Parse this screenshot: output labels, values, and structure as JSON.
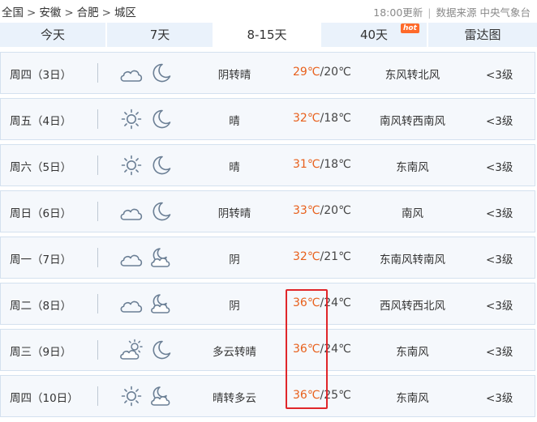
{
  "breadcrumb": [
    "全国",
    "安徽",
    "合肥",
    "城区"
  ],
  "breadcrumb_separator": ">",
  "update_time": "18:00更新",
  "data_source": "数据来源 中央气象台",
  "tabs": [
    {
      "label": "今天"
    },
    {
      "label": "7天"
    },
    {
      "label": "8-15天",
      "active": true
    },
    {
      "label": "40天",
      "badge": "hot"
    },
    {
      "label": "雷达图"
    }
  ],
  "forecast": [
    {
      "day": "周四（3日）",
      "icon_day": "cloud-icon",
      "icon_night": "moon-icon",
      "condition": "阴转晴",
      "high": "29℃",
      "low": "/20℃",
      "wind": "东风转北风",
      "level": "<3级"
    },
    {
      "day": "周五（4日）",
      "icon_day": "sun-icon",
      "icon_night": "moon-icon",
      "condition": "晴",
      "high": "32℃",
      "low": "/18℃",
      "wind": "南风转西南风",
      "level": "<3级"
    },
    {
      "day": "周六（5日）",
      "icon_day": "sun-icon",
      "icon_night": "moon-icon",
      "condition": "晴",
      "high": "31℃",
      "low": "/18℃",
      "wind": "东南风",
      "level": "<3级"
    },
    {
      "day": "周日（6日）",
      "icon_day": "cloud-icon",
      "icon_night": "moon-icon",
      "condition": "阴转晴",
      "high": "33℃",
      "low": "/20℃",
      "wind": "南风",
      "level": "<3级"
    },
    {
      "day": "周一（7日）",
      "icon_day": "cloud-icon",
      "icon_night": "moon-cloud-icon",
      "condition": "阴",
      "high": "32℃",
      "low": "/21℃",
      "wind": "东南风转南风",
      "level": "<3级"
    },
    {
      "day": "周二（8日）",
      "icon_day": "cloud-icon",
      "icon_night": "moon-cloud-icon",
      "condition": "阴",
      "high": "36℃",
      "low": "/24℃",
      "wind": "西风转西北风",
      "level": "<3级"
    },
    {
      "day": "周三（9日）",
      "icon_day": "sun-cloud-icon",
      "icon_night": "moon-icon",
      "condition": "多云转晴",
      "high": "36℃",
      "low": "/24℃",
      "wind": "东南风",
      "level": "<3级"
    },
    {
      "day": "周四（10日）",
      "icon_day": "sun-icon",
      "icon_night": "moon-cloud-icon",
      "condition": "晴转多云",
      "high": "36℃",
      "low": "/25℃",
      "wind": "东南风",
      "level": "<3级"
    }
  ],
  "colors": {
    "tab_bg": "#eaf2fb",
    "row_bg": "#f5f8fc",
    "row_border": "#d4e1ef",
    "high_temp": "#e8601c",
    "highlight": "#e0262a",
    "icon_stroke": "#6b7f95"
  }
}
